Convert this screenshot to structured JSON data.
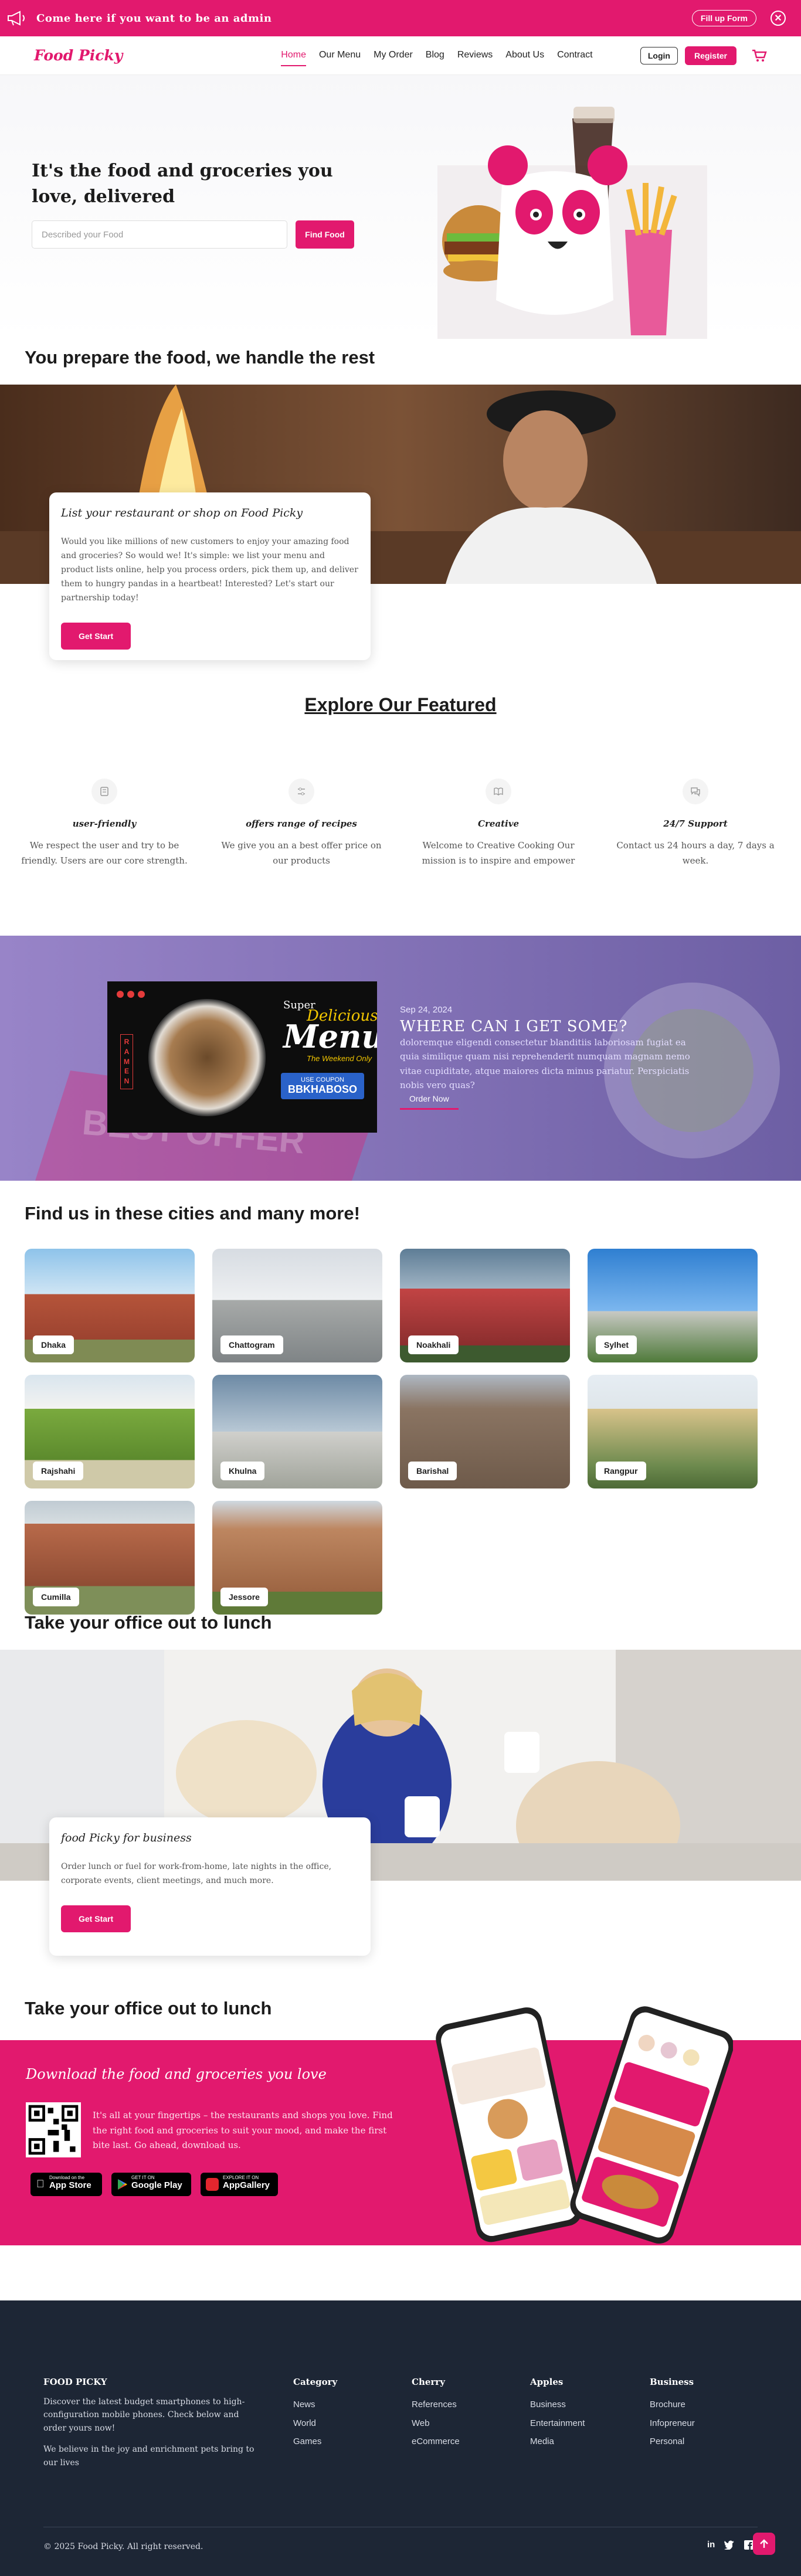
{
  "topbar": {
    "message": "Come here if you want to be an admin",
    "button": "Fill up Form",
    "close": "✕"
  },
  "nav": {
    "logo": "Food Picky",
    "items": [
      {
        "label": "Home",
        "active": true
      },
      {
        "label": "Our Menu"
      },
      {
        "label": "My Order"
      },
      {
        "label": "Blog"
      },
      {
        "label": "Reviews"
      },
      {
        "label": "About Us"
      },
      {
        "label": "Contract"
      }
    ],
    "login": "Login",
    "register": "Register"
  },
  "hero": {
    "title": "It's the food and groceries you love, delivered",
    "placeholder": "Described your Food",
    "button": "Find Food"
  },
  "prepare": {
    "title": "You prepare the food, we handle the rest",
    "card_title": "List your restaurant or shop on Food Picky",
    "card_text": "Would you like millions of new customers to enjoy your amazing food and groceries? So would we! It's simple: we list your menu and product lists online, help you process orders, pick them up, and deliver them to hungry pandas in a heartbeat! Interested? Let's start our partnership today!",
    "button": "Get Start"
  },
  "explore": {
    "title": "Explore Our Featured",
    "items": [
      {
        "icon": "gift-icon",
        "title": "user-friendly",
        "text": "We respect the user and try to be friendly. Users are our core strength."
      },
      {
        "icon": "sliders-icon",
        "title": "offers range of recipes",
        "text": "We give you an a best offer price on our products"
      },
      {
        "icon": "book-icon",
        "title": "Creative",
        "text": "Welcome to Creative Cooking Our mission is to inspire and empower"
      },
      {
        "icon": "chat-icon",
        "title": "24/7 Support",
        "text": "Contact us 24 hours a day, 7 days a week."
      }
    ]
  },
  "promo": {
    "poster_super": "Super",
    "poster_delicious": "Delicious",
    "poster_menu": "Menu",
    "poster_tag": "The Weekend Only",
    "poster_coupon_label": "USE COUPON",
    "poster_coupon": "BBKHABOSO",
    "poster_ramen": "RAMEN",
    "banner_text": "BEST OFFER",
    "date": "Sep 24, 2024",
    "title": "WHERE CAN I GET SOME?",
    "text": "doloremque eligendi consectetur blanditiis laboriosam fugiat ea quia similique quam nisi reprehenderit numquam magnam nemo vitae cupiditate, atque maiores dicta minus pariatur. Perspiciatis nobis vero quas?",
    "button": "Order Now"
  },
  "cities": {
    "title": "Find us in these cities and many more!",
    "items": [
      {
        "name": "Dhaka"
      },
      {
        "name": "Chattogram"
      },
      {
        "name": "Noakhali"
      },
      {
        "name": "Sylhet"
      },
      {
        "name": "Rajshahi"
      },
      {
        "name": "Khulna"
      },
      {
        "name": "Barishal"
      },
      {
        "name": "Rangpur"
      },
      {
        "name": "Cumilla"
      },
      {
        "name": "Jessore"
      }
    ]
  },
  "business": {
    "title": "Take your office out to lunch",
    "card_title": "food Picky for business",
    "card_text": "Order lunch or fuel for work-from-home, late nights in the office, corporate events, client meetings, and much more.",
    "button": "Get Start"
  },
  "app": {
    "title": "Take your office out to lunch",
    "banner_title": "Download the food and groceries you love",
    "text": "It's all at your fingertips – the restaurants and shops you love. Find the right food and groceries to suit your mood, and make the first bite last. Go ahead, download us.",
    "stores": [
      {
        "small": "Download on the",
        "name": "App Store"
      },
      {
        "small": "GET IT ON",
        "name": "Google Play"
      },
      {
        "small": "EXPLORE IT ON",
        "name": "AppGallery"
      }
    ]
  },
  "footer": {
    "logo": "FOOD PICKY",
    "about": "Discover the latest budget smartphones to high-configuration mobile phones. Check below and order yours now!",
    "about2": "We believe in the joy and enrichment pets bring to our lives",
    "columns": [
      {
        "title": "Category",
        "links": [
          "News",
          "World",
          "Games"
        ]
      },
      {
        "title": "Cherry",
        "links": [
          "References",
          "Web",
          "eCommerce"
        ]
      },
      {
        "title": "Apples",
        "links": [
          "Business",
          "Entertainment",
          "Media"
        ]
      },
      {
        "title": "Business",
        "links": [
          "Brochure",
          "Infopreneur",
          "Personal"
        ]
      }
    ],
    "copyright": "© 2025 Food Picky. All right reserved."
  },
  "colors": {
    "brand": "#e2196e",
    "footer": "#1d2635",
    "promo": "#7b6cb5"
  }
}
